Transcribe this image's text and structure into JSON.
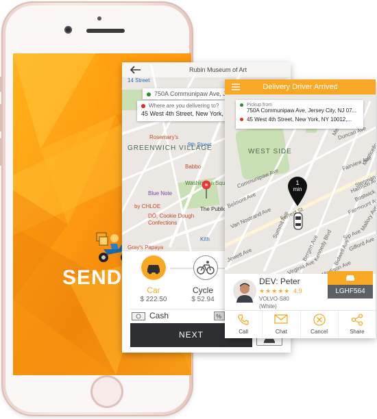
{
  "launch": {
    "brand": "SENDER"
  },
  "order": {
    "back_icon": "arrow-left-icon",
    "map_poi": [
      "Rubin Museum of Art",
      "Rosemary's",
      "GREENWICH VILLAGE",
      "Babbo",
      "Washington Square Park",
      "Blue Note",
      "by CHLOE",
      "DŌ, Cookie Dough Confections",
      "The Public",
      "Kith",
      "9th Street",
      "14 Street",
      "Gray's Papaya"
    ],
    "pickup_preview": "750A Communipaw Ave, Jersey City",
    "destination_label": "Where are you delivering to?",
    "destination_value": "45 West 4th Street,  New York,  NY",
    "vehicles": [
      {
        "name": "Car",
        "price": "$ 222.50",
        "selected": true,
        "color": "#f9a826"
      },
      {
        "name": "Cycle",
        "price": "$ 52.94",
        "selected": false,
        "color": "#555555"
      }
    ],
    "payment": "Cash",
    "next_label": "NEXT"
  },
  "arrived": {
    "header_title": "Delivery Driver Arrived",
    "menu_icon": "hamburger-icon",
    "pickup_label": "Pickup from",
    "pickup_value": "750A Communipaw Ave, Jersey City,  NJ 07...",
    "dropoff_value": "45 West 4th Street,  New York,  NY 10012,...",
    "eta_number": "1",
    "eta_unit": "min",
    "map_poi": [
      "WEST SIDE",
      "Duncan Ave",
      "Communipaw Ave",
      "Fairview Ave",
      "Fairmount Ave",
      "Summit Ave",
      "Bergen Ave",
      "Kennedy Blvd",
      "Bidwell Ave",
      "Bostwick Ave",
      "Harrison Ave",
      "Forrest St",
      "Mallory Ave",
      "Sip Ave",
      "Gifford Ave",
      "Stegman Pkwy",
      "Van Nostrand Ave",
      "Belmont Ave",
      "Monticello Ave",
      "Mercer St",
      "Jewett Ave",
      "Virginia Ave",
      "Madison Ave"
    ],
    "driver_name": "DEV: Peter",
    "rating": "4.9",
    "stars": 5,
    "vehicle_model": "VOLVO-S80",
    "vehicle_color": "(White)",
    "plate": "LGHF564",
    "accent": "#f9a826",
    "actions": [
      {
        "label": "Call",
        "icon": "phone-icon",
        "color": "#f9a826"
      },
      {
        "label": "Chat",
        "icon": "mail-icon",
        "color": "#f9a826"
      },
      {
        "label": "Cancel",
        "icon": "cancel-icon",
        "color": "#f9a826"
      },
      {
        "label": "Share",
        "icon": "share-icon",
        "color": "#f9a826"
      }
    ]
  }
}
